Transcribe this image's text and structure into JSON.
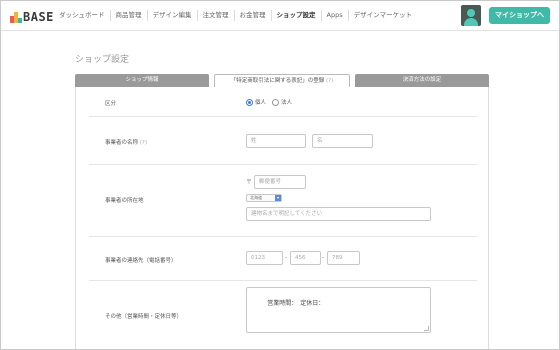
{
  "logo": {
    "text": "BASE"
  },
  "nav": {
    "items": [
      {
        "label": "ダッシュボード",
        "active": false
      },
      {
        "label": "商品管理",
        "active": false
      },
      {
        "label": "デザイン編集",
        "active": false
      },
      {
        "label": "注文管理",
        "active": false
      },
      {
        "label": "お金管理",
        "active": false
      },
      {
        "label": "ショップ設定",
        "active": true
      },
      {
        "label": "Apps",
        "active": false
      },
      {
        "label": "デザインマーケット",
        "active": false
      }
    ]
  },
  "header": {
    "myshop_label": "マイショップへ"
  },
  "page": {
    "title": "ショップ設定"
  },
  "tabs": [
    {
      "label": "ショップ情報",
      "help": ""
    },
    {
      "label": "「特定商取引法に関する表記」の登録",
      "help": "(?)"
    },
    {
      "label": "決済方法の設定",
      "help": ""
    }
  ],
  "form": {
    "category": {
      "label": "区分",
      "options": [
        {
          "label": "個人",
          "selected": true
        },
        {
          "label": "法人",
          "selected": false
        }
      ]
    },
    "name": {
      "label": "事業者の名称",
      "help": "(?)",
      "last_placeholder": "姓",
      "first_placeholder": "名"
    },
    "address": {
      "label": "事業者の所在地",
      "zip_mark": "〒",
      "zip_placeholder": "郵便番号",
      "prefecture": "北海道",
      "building_placeholder": "建物名まで明記してください"
    },
    "phone": {
      "label": "事業者の連絡先（電話番号）",
      "part1": "0123",
      "part2": "456",
      "part3": "789",
      "separator": "-"
    },
    "other": {
      "label": "その他（営業時間・定休日等）",
      "value": "営業時間：　定休日："
    }
  }
}
